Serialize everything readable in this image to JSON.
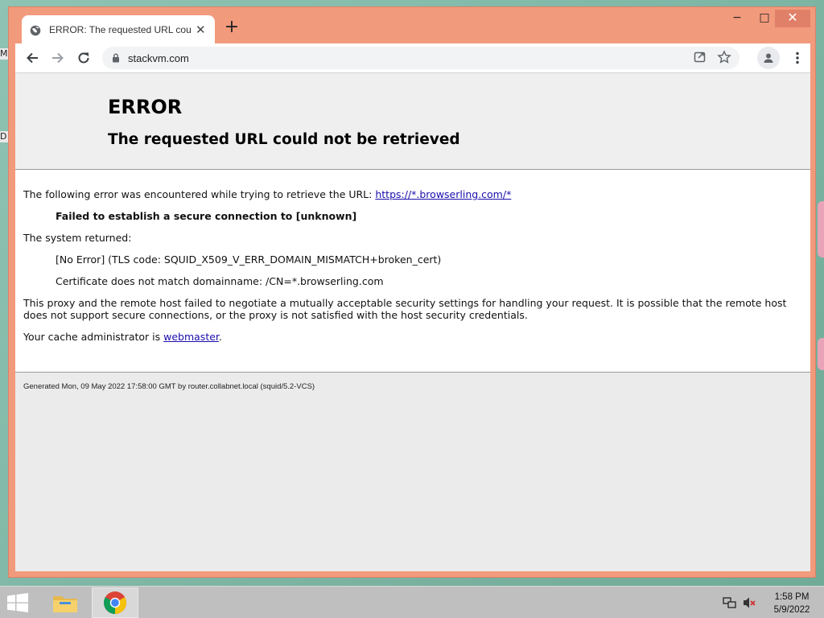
{
  "desktop": {
    "left_slivers": [
      "M",
      "D"
    ]
  },
  "browser": {
    "tab_title": "ERROR: The requested URL could not be retrieved",
    "tab_close": "✕",
    "new_tab": "+",
    "window_controls": {
      "minimize": "−",
      "maximize": "□",
      "close": "✕"
    },
    "url": "stackvm.com"
  },
  "page": {
    "heading": "ERROR",
    "subheading": "The requested URL could not be retrieved",
    "intro": "The following error was encountered while trying to retrieve the URL: ",
    "intro_link": "https://*.browserling.com/*",
    "failure": "Failed to establish a secure connection to [unknown]",
    "system_returned": "The system returned:",
    "tls_code": "[No Error] (TLS code: SQUID_X509_V_ERR_DOMAIN_MISMATCH+broken_cert)",
    "cert_msg": "Certificate does not match domainname: /CN=*.browserling.com",
    "explanation": "This proxy and the remote host failed to negotiate a mutually acceptable security settings for handling your request. It is possible that the remote host does not support secure connections, or the proxy is not satisfied with the host security credentials.",
    "admin_prefix": "Your cache administrator is ",
    "admin_link": "webmaster",
    "admin_suffix": ".",
    "footer": "Generated Mon, 09 May 2022 17:58:00 GMT by router.collabnet.local (squid/5.2-VCS)"
  },
  "taskbar": {
    "time": "1:58 PM",
    "date": "5/9/2022"
  },
  "icons": {
    "tab": "globe-icon",
    "nav": [
      "back-arrow-icon",
      "forward-arrow-icon",
      "reload-icon"
    ],
    "omnibox": [
      "lock-icon",
      "share-icon",
      "star-icon"
    ],
    "toolbar": [
      "profile-icon",
      "menu-kebab-icon"
    ],
    "taskbar": [
      "windows-start-icon",
      "file-explorer-icon",
      "chrome-icon",
      "network-icon",
      "volume-muted-icon"
    ]
  },
  "colors": {
    "window_frame": "#f29a7c",
    "link": "#1a0dab",
    "desktop": "#7fb7a6",
    "taskbar": "#bfbfbf"
  }
}
